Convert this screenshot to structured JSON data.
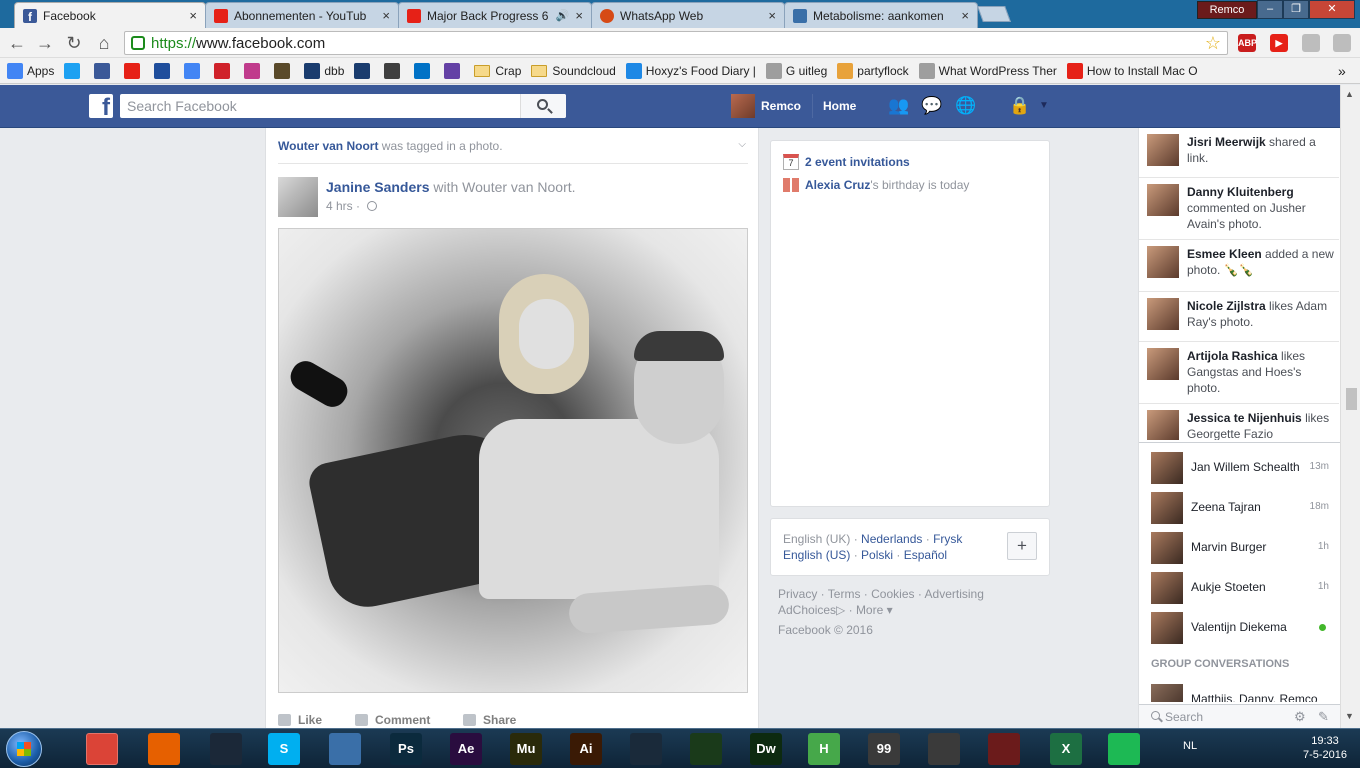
{
  "browser": {
    "tabs": [
      {
        "title": "Facebook",
        "active": true,
        "favicon_color": "#3b5998"
      },
      {
        "title": "Abonnementen - YouTub",
        "active": false,
        "favicon_color": "#e62117"
      },
      {
        "title": "Major Back Progress 6",
        "active": false,
        "favicon_color": "#e62117"
      },
      {
        "title": "WhatsApp Web",
        "active": false,
        "favicon_color": "#d64a16"
      },
      {
        "title": "Metabolisme: aankomen",
        "active": false,
        "favicon_color": "#3a6fa8"
      }
    ],
    "close_glyph": "×",
    "profile_name": "Remco",
    "window_controls": [
      "–",
      "❐",
      "✕"
    ],
    "nav": {
      "back": "←",
      "forward": "→",
      "reload": "↻",
      "home": "⌂"
    },
    "address": {
      "scheme": "https://",
      "host": "www.facebook.com"
    },
    "star_glyph": "☆",
    "menu_glyph": "≡",
    "extensions": [
      {
        "label": "ABP",
        "color": "#c91d1d"
      },
      {
        "label": "▶",
        "color": "#e62117"
      },
      {
        "label": "",
        "color": "#bdbdbd"
      },
      {
        "label": "",
        "color": "#bdbdbd"
      }
    ],
    "bookmarks": [
      {
        "label": "Apps",
        "icon": "apps-grid-icon",
        "color": "#4285f4"
      },
      {
        "label": "",
        "icon": "twitter-icon",
        "color": "#1da1f2"
      },
      {
        "label": "",
        "icon": "facebook-icon",
        "color": "#3b5998"
      },
      {
        "label": "",
        "icon": "youtube-icon",
        "color": "#e62117"
      },
      {
        "label": "",
        "icon": "af-icon",
        "color": "#1f4e9c"
      },
      {
        "label": "",
        "icon": "google-icon",
        "color": "#4285f4"
      },
      {
        "label": "",
        "icon": "d-icon",
        "color": "#d0222a"
      },
      {
        "label": "",
        "icon": "w-icon",
        "color": "#c03b8c"
      },
      {
        "label": "",
        "icon": "player-icon",
        "color": "#5a4a2a"
      },
      {
        "label": "dbb",
        "icon": "dbb-icon",
        "color": "#1a3c6e"
      },
      {
        "label": "",
        "icon": "download-icon",
        "color": "#1a3c6e"
      },
      {
        "label": "",
        "icon": "instagram-icon",
        "color": "#3f3f3f"
      },
      {
        "label": "",
        "icon": "outlook-icon",
        "color": "#0072c6"
      },
      {
        "label": "",
        "icon": "twitch-icon",
        "color": "#6441a5"
      },
      {
        "label": "Crap",
        "icon": "folder-icon",
        "color": "#c99e2a"
      },
      {
        "label": "Soundcloud",
        "icon": "folder-icon",
        "color": "#c99e2a"
      },
      {
        "label": "Hoxyz's Food Diary |",
        "icon": "fitness-icon",
        "color": "#1e88e5"
      },
      {
        "label": "G uitleg",
        "icon": "page-icon",
        "color": "#9e9e9e"
      },
      {
        "label": "partyflock",
        "icon": "partyflock-icon",
        "color": "#e8a23a"
      },
      {
        "label": "What WordPress Ther",
        "icon": "search-page-icon",
        "color": "#9e9e9e"
      },
      {
        "label": "How to Install Mac O",
        "icon": "youtube-icon",
        "color": "#e62117"
      }
    ],
    "overflow_glyph": "»"
  },
  "facebook": {
    "logo_letter": "f",
    "search": {
      "placeholder": "Search Facebook"
    },
    "profile_name": "Remco",
    "home_label": "Home",
    "nav_icons": {
      "friends": "👥",
      "messages": "💬",
      "notifications": "🌐",
      "privacy": "🔒",
      "dropdown": "▼"
    },
    "story": {
      "actor": "Wouter van Noort",
      "action": " was tagged in a photo.",
      "chevron": "⌵"
    },
    "post": {
      "author": "Janine Sanders",
      "with": " with Wouter van Noort.",
      "time": "4 hrs · "
    },
    "actions": {
      "like": "Like",
      "comment": "Comment",
      "share": "Share"
    },
    "events": {
      "calendar_day": "7",
      "invitations": "2 event invitations",
      "birthday_name": "Alexia Cruz",
      "birthday_text": "'s birthday is today"
    },
    "languages": {
      "current": "English (UK)",
      "options": [
        "Nederlands",
        "Frysk",
        "English (US)",
        "Polski",
        "Español"
      ],
      "dot": " · ",
      "more_glyph": "+"
    },
    "footer": {
      "links": [
        "Privacy",
        "Terms",
        "Cookies",
        "Advertising",
        "AdChoices",
        "More"
      ],
      "adchoices_glyph": "▷",
      "more_glyph": "▾",
      "copyright": "Facebook © 2016"
    },
    "ticker": [
      {
        "name": "Jisri Meerwijk",
        "text": " shared a link."
      },
      {
        "name": "Danny Kluitenberg",
        "text": " commented on Jusher Avain's photo."
      },
      {
        "name": "Esmee Kleen",
        "text": " added a new photo. 🍾🍾"
      },
      {
        "name": "Nicole Zijlstra",
        "text": " likes Adam Ray's photo."
      },
      {
        "name": "Artijola Rashica",
        "text": " likes Gangstas and Hoes's photo."
      },
      {
        "name": "Jessica te Nijenhuis",
        "text": " likes Georgette Fazio"
      }
    ],
    "chat": {
      "friends": [
        {
          "name": "Jan Willem Schealth",
          "time": "13m",
          "online": false
        },
        {
          "name": "Zeena Tajran",
          "time": "18m",
          "online": false
        },
        {
          "name": "Marvin Burger",
          "time": "1h",
          "online": false
        },
        {
          "name": "Aukje Stoeten",
          "time": "1h",
          "online": false
        },
        {
          "name": "Valentijn Diekema",
          "time": "",
          "online": true
        }
      ],
      "group_header": "GROUP CONVERSATIONS",
      "group": "Matthijs, Danny, Remco",
      "search_placeholder": "Search",
      "settings_glyph": "⚙",
      "compose_glyph": "✎"
    }
  },
  "taskbar": {
    "apps": [
      {
        "label": "",
        "icon": "chrome-icon",
        "color": "#db4437"
      },
      {
        "label": "",
        "icon": "firefox-icon",
        "color": "#e66000"
      },
      {
        "label": "",
        "icon": "steam-icon",
        "color": "#1b2838"
      },
      {
        "label": "S",
        "icon": "skype-icon",
        "color": "#00aff0"
      },
      {
        "label": "",
        "icon": "network-icon",
        "color": "#3a6fa8"
      },
      {
        "label": "Ps",
        "icon": "photoshop-icon",
        "color": "#0b2a3d"
      },
      {
        "label": "Ae",
        "icon": "after-effects-icon",
        "color": "#2a0d3f"
      },
      {
        "label": "Mu",
        "icon": "muse-icon",
        "color": "#2a2a0a"
      },
      {
        "label": "Ai",
        "icon": "illustrator-icon",
        "color": "#3a1a05"
      },
      {
        "label": "",
        "icon": "film-icon",
        "color": "#1a2a3a"
      },
      {
        "label": "",
        "icon": "fl-studio-icon",
        "color": "#1a3a1a"
      },
      {
        "label": "Dw",
        "icon": "dreamweaver-icon",
        "color": "#0d2a10"
      },
      {
        "label": "H",
        "icon": "h-app-icon",
        "color": "#46a84a"
      },
      {
        "label": "99",
        "icon": "laptop-icon",
        "color": "#3a3a3a"
      },
      {
        "label": "",
        "icon": "disc-icon",
        "color": "#3a3a3a"
      },
      {
        "label": "",
        "icon": "game-icon",
        "color": "#6b1b1b"
      },
      {
        "label": "X",
        "icon": "excel-icon",
        "color": "#1d6f42"
      },
      {
        "label": "",
        "icon": "spotify-icon",
        "color": "#1db954"
      }
    ],
    "language": "NL",
    "time": "19:33",
    "date": "7-5-2016"
  }
}
